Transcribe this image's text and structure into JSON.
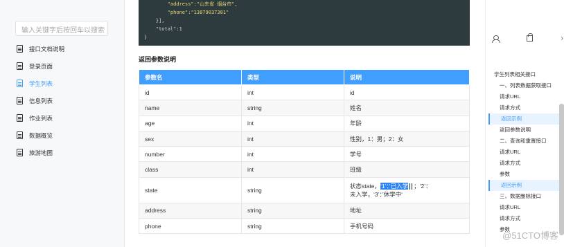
{
  "sidebar": {
    "search_placeholder": "输入关键字后按回车以搜索",
    "items": [
      {
        "label": "接口文档说明"
      },
      {
        "label": "登录页面"
      },
      {
        "label": "学生列表"
      },
      {
        "label": "信息列表"
      },
      {
        "label": "作业列表"
      },
      {
        "label": "数据概览"
      },
      {
        "label": "旅游地图"
      }
    ]
  },
  "code": {
    "line1_key": "\"address\"",
    "line1_val": ":\"山东省 烟台市\",",
    "line2_key": "\"phone\"",
    "line2_val": ":\"13879037381\"",
    "line3": "    }],",
    "line4": "    \"total\":1",
    "line5": "}"
  },
  "section_title": "返回参数说明",
  "table": {
    "headers": [
      "参数名",
      "类型",
      "说明"
    ],
    "rows": [
      [
        "id",
        "int",
        "id"
      ],
      [
        "name",
        "string",
        "姓名"
      ],
      [
        "age",
        "int",
        "年龄"
      ],
      [
        "sex",
        "int",
        "性别，1：男；2：女"
      ],
      [
        "number",
        "int",
        "学号"
      ],
      [
        "class",
        "int",
        "班级"
      ],
      [
        "state",
        "string",
        ""
      ],
      [
        "address",
        "string",
        "地址"
      ],
      [
        "phone",
        "string",
        "手机号码"
      ]
    ],
    "state_desc_prefix": "状态state，",
    "state_desc_highlight": "‘1’：’已入学",
    "state_desc_suffix": "；‘2’：",
    "state_desc_line2": "未入学，‘3’：’休学中‘"
  },
  "toc": {
    "items": [
      {
        "label": "学生列表相关接口"
      },
      {
        "label": "一、列表数据获取接口"
      },
      {
        "label": "请求URL"
      },
      {
        "label": "请求方式"
      },
      {
        "label": "返回示例"
      },
      {
        "label": "返回参数说明"
      },
      {
        "label": "二、查询和重置接口"
      },
      {
        "label": "请求URL"
      },
      {
        "label": "请求方式"
      },
      {
        "label": "参数"
      },
      {
        "label": "返回示例"
      },
      {
        "label": "三、数据删除接口"
      },
      {
        "label": "请求URL"
      },
      {
        "label": "请求方式"
      },
      {
        "label": "参数"
      }
    ]
  },
  "watermark": "@51CTO博客",
  "colors": {
    "accent": "#409eff",
    "code_bg": "#2d3a3e",
    "highlight": "#2f84f3"
  }
}
